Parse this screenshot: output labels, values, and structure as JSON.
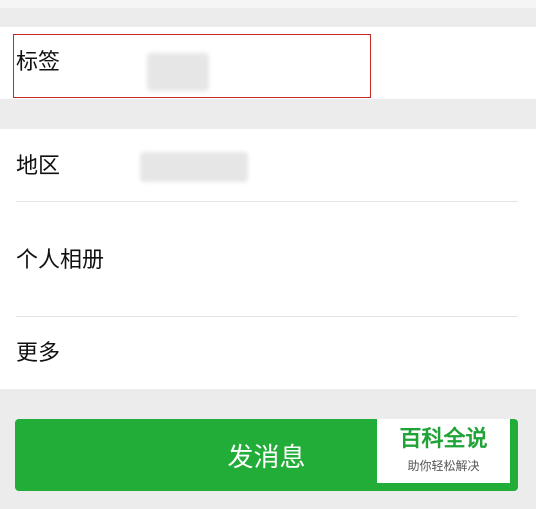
{
  "profile": {
    "tags_label": "标签",
    "region_label": "地区",
    "album_label": "个人相册",
    "more_label": "更多"
  },
  "actions": {
    "send_message_label": "发消息"
  },
  "watermark": {
    "title": "百科全说",
    "subtitle": "助你轻松解决"
  },
  "colors": {
    "accent": "#22ac38",
    "highlight_border": "#c62828"
  }
}
